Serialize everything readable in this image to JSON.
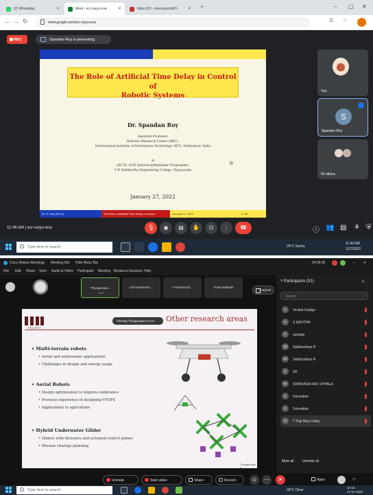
{
  "meet": {
    "tabs": [
      {
        "label": "(2) WhatsApp",
        "color": "#25d366"
      },
      {
        "label": "Meet - ecr-swyo-ena",
        "color": "#00832d"
      },
      {
        "label": "https://20 - skarnanumd03 -",
        "color": "#c4302b"
      }
    ],
    "new_tab": "+",
    "window_controls": [
      "–",
      "▢",
      "✕"
    ],
    "url": "meet.google.com/ecr-swyo-ena",
    "rec_label": "REC",
    "presenting_text": "Spandan Roy is presenting",
    "slide": {
      "title_line1": "The Role of Artificial Time Delay in Control of",
      "title_line2": "Robotic Systems",
      "author": "Dr. Spandan Roy",
      "role": "Assistant Professor,",
      "center": "Robotics Research Center (RRC),",
      "institute": "International Institute of Information Technology (IIIT), Hyderabad, India",
      "at": "at",
      "program": "AICTE- ISTE Induction/Refresher Programme,",
      "college": "V R Siddhartha Engineering College, Vijayawada",
      "date": "January 27, 2022",
      "footer_left": "Dr. S. Roy (IIIT-H)",
      "footer_mid": "The Role of Artificial Time Delay in Control",
      "footer_right": "January 27, 2022",
      "footer_page": "1 / 46"
    },
    "tiles": [
      {
        "name": "You"
      },
      {
        "name": "Spandan Roy",
        "initial": "S"
      },
      {
        "name": "50 others"
      }
    ],
    "meeting_time": "11:46 AM | ecr-swyo-ena",
    "taskbar_search": "Type here to search",
    "tray": "26°C Sunny",
    "clock_time": "11:46 AM",
    "clock_date": "1/27/2022"
  },
  "webex": {
    "title_items": [
      "Cisco Webex Meetings",
      "Meeting Info",
      "Hide Menu Bar"
    ],
    "title_time": "04:56:05",
    "menu": [
      "File",
      "Edit",
      "Share",
      "View",
      "Audio & Video",
      "Participant",
      "Meeting",
      "Breakout Sessions",
      "Help"
    ],
    "thumbs": [
      {
        "label": "Thiyagarajan...",
        "sub": "Host"
      },
      {
        "label": "135 Narasimha ...",
        "sub": ""
      },
      {
        "label": "A Nanchandr...",
        "sub": ""
      },
      {
        "label": "Akula Mallaiah",
        "sub": ""
      }
    ],
    "layout_label": "Layout",
    "viewing_text": "Viewing Thyagarajan's scre...",
    "slide": {
      "logo_text": "TIRUPATI",
      "title": "Other research areas",
      "sections": [
        {
          "head": "Multi-terrain robots",
          "items": [
            "Aerial and underwater applications",
            "Challenges in design and energy usage"
          ]
        },
        {
          "head": "Aerial Robots",
          "items": [
            "Design optimization to improve endurance",
            "Previous experience in designing VTOPS",
            "Applications to agriculture"
          ]
        },
        {
          "head": "Hybrid Underwater Glider",
          "items": [
            "Gliders with thrusters and actuated control planes",
            "Mission strategy planning"
          ]
        }
      ],
      "page": "Thiyagarajan P"
    },
    "participants_header": "Participants (51)",
    "search_placeholder": "Search",
    "participants": [
      {
        "name": "Venkat Gadige",
        "initial": "V"
      },
      {
        "name": "S.KAVITHA",
        "initial": "S"
      },
      {
        "name": "sankalp",
        "initial": "S"
      },
      {
        "name": "Siddhardhan R",
        "initial": "SR"
      },
      {
        "name": "Siddhardhan R",
        "initial": "SR"
      },
      {
        "name": "SK",
        "initial": "S"
      },
      {
        "name": "SRINIVASA RAO UPPALA",
        "initial": "SU"
      },
      {
        "name": "Srinivallan",
        "initial": "S"
      },
      {
        "name": "Srinivallan",
        "initial": "S"
      },
      {
        "name": "T.Thiji Mary Dalby",
        "initial": "TD"
      }
    ],
    "mute_all": "Mute all",
    "unmute_all": "Unmute all",
    "controls": {
      "unmute": "Unmute",
      "video": "Start video",
      "share": "Share",
      "record": "Record",
      "apps": "Apps"
    },
    "taskbar_search": "Type here to search",
    "tray": "30°C Clear",
    "clock_time": "10:16",
    "clock_date": "27-01-2022"
  },
  "colors": {
    "meet_bg": "#202124",
    "rec_red": "#ea4335",
    "slide1_title_bg": "#fde74c",
    "slide1_title_text": "#c21a16",
    "slide2_title": "#a3322f",
    "drone_green": "#3aa83a",
    "webex_bg": "#121212"
  }
}
